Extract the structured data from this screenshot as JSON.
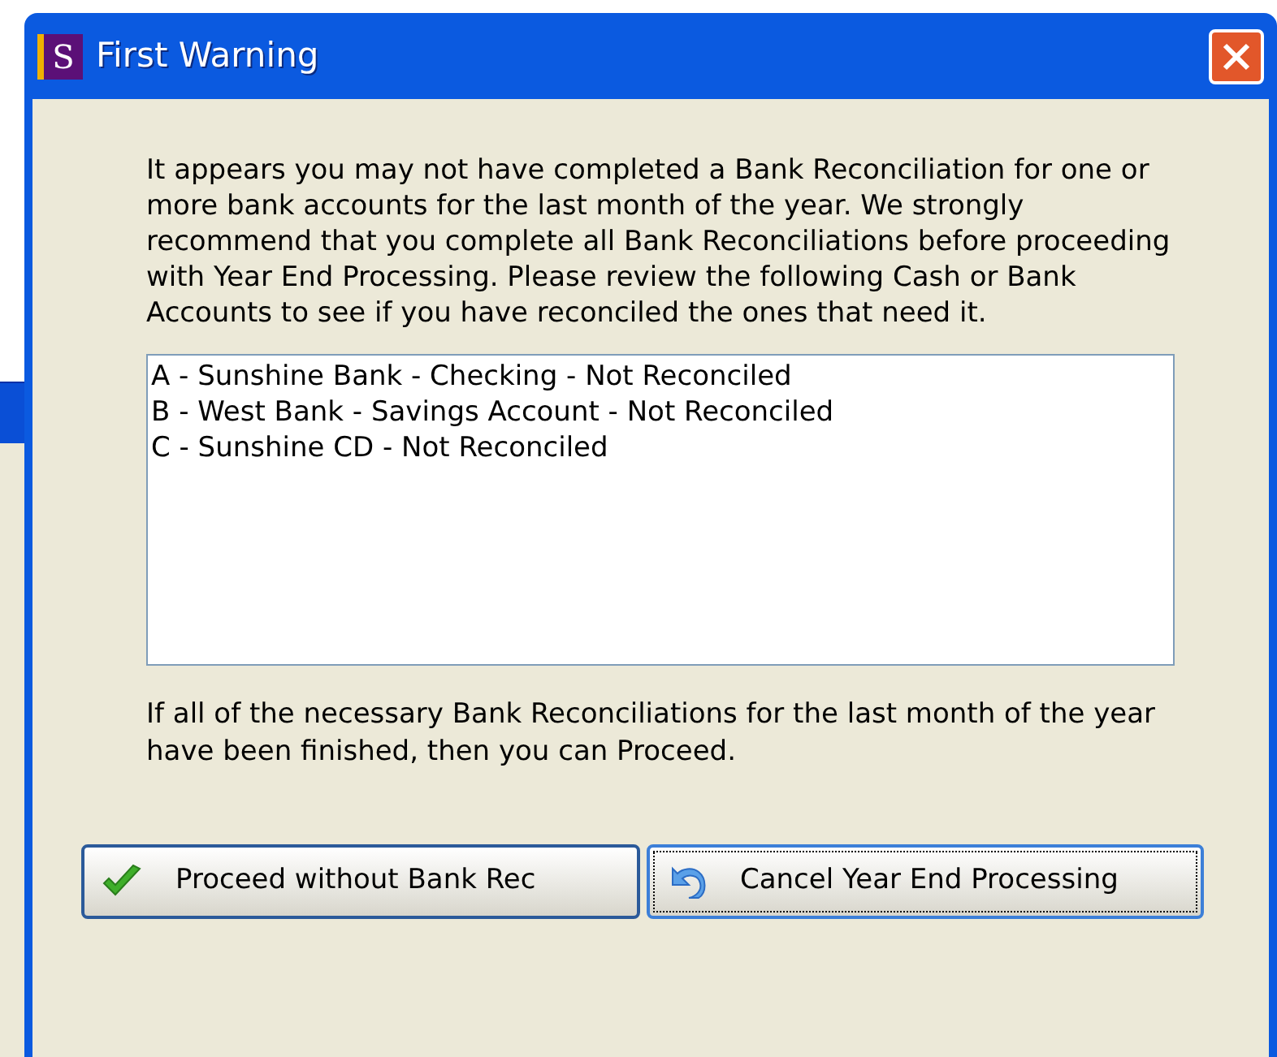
{
  "window": {
    "title": "First Warning",
    "app_icon": "S"
  },
  "message": "It appears you may not have completed a Bank Reconciliation for one or more bank accounts for the last month of the year. We strongly recommend that you complete all Bank Reconciliations before proceeding with Year End Processing.  Please review the following Cash or Bank Accounts to see if you have reconciled the ones that need it.",
  "accounts": [
    "A - Sunshine Bank - Checking - Not Reconciled",
    "B - West Bank - Savings Account - Not Reconciled",
    "C - Sunshine CD - Not Reconciled"
  ],
  "footer": "If all of the necessary Bank Reconciliations for the last month of the year have been finished, then you can Proceed.",
  "buttons": [
    {
      "label": "Proceed without Bank Rec",
      "focused": false
    },
    {
      "label": "Cancel Year End Processing",
      "focused": true
    }
  ]
}
